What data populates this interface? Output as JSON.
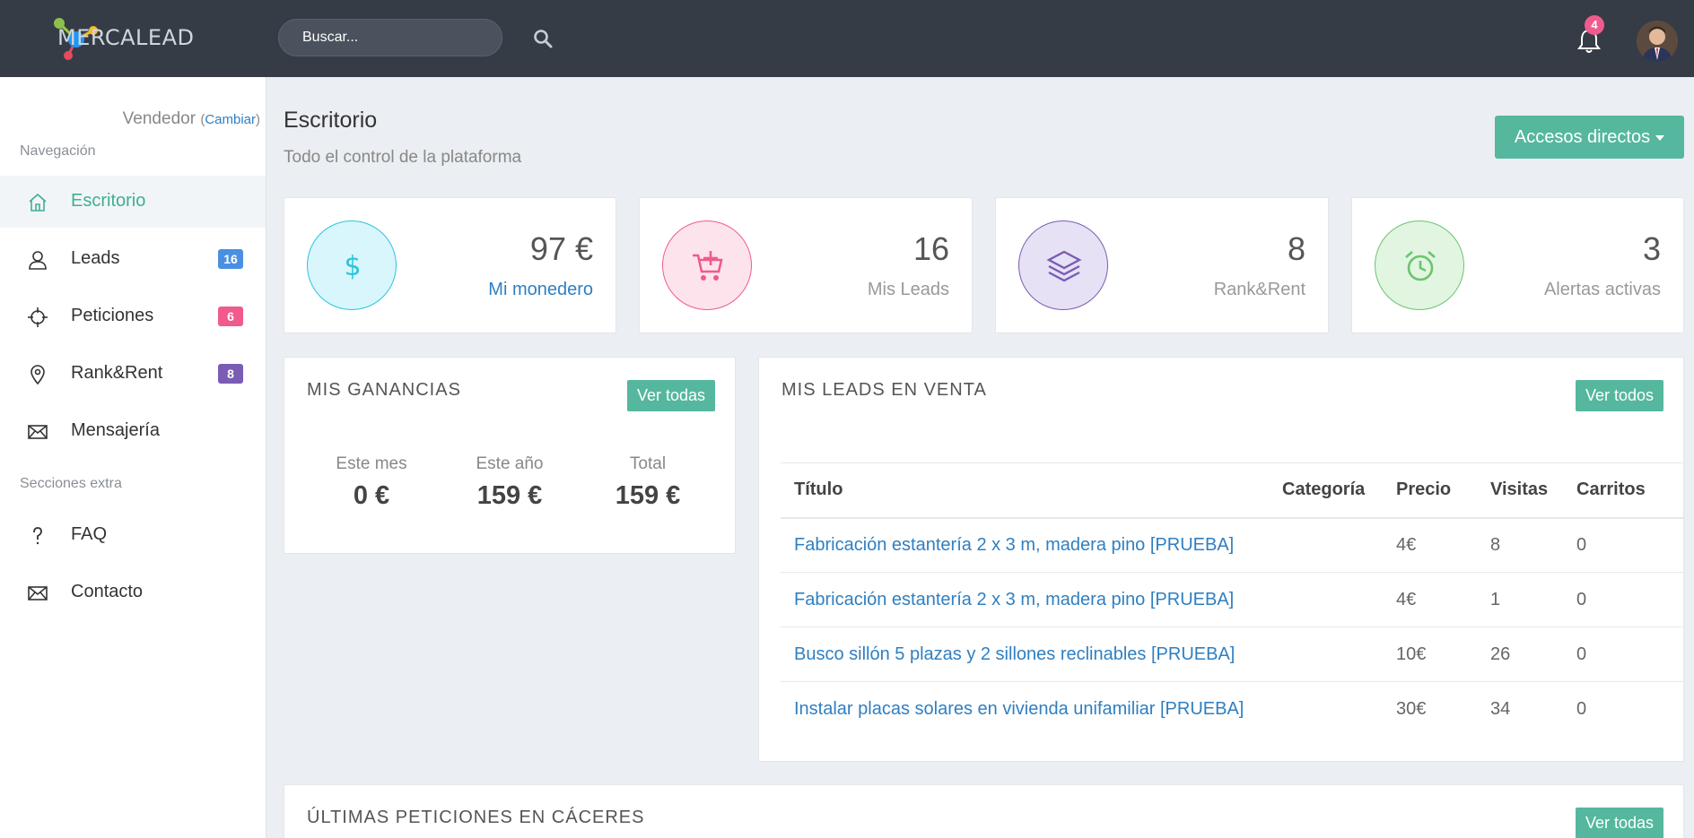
{
  "header": {
    "logo_text": "MERCALEAD",
    "search_placeholder": "Buscar...",
    "notification_count": "4"
  },
  "sidebar": {
    "role": "Vendedor",
    "change_label": "Cambiar",
    "section_nav": "Navegación",
    "section_extra": "Secciones extra",
    "items": [
      {
        "label": "Escritorio",
        "icon": "home-icon"
      },
      {
        "label": "Leads",
        "icon": "user-icon",
        "badge": "16",
        "badge_color": "#4a90e2"
      },
      {
        "label": "Peticiones",
        "icon": "crosshair-icon",
        "badge": "6",
        "badge_color": "#f05a8d"
      },
      {
        "label": "Rank&Rent",
        "icon": "map-pin-icon",
        "badge": "8",
        "badge_color": "#7a5cb5"
      },
      {
        "label": "Mensajería",
        "icon": "envelope-icon"
      }
    ],
    "extra_items": [
      {
        "label": "FAQ",
        "icon": "question-icon"
      },
      {
        "label": "Contacto",
        "icon": "envelope-icon"
      }
    ]
  },
  "page": {
    "title": "Escritorio",
    "subtitle": "Todo el control de la plataforma",
    "quick_access": "Accesos directos"
  },
  "stats": [
    {
      "value": "97 €",
      "label": "Mi monedero",
      "icon": "dollar-icon",
      "color": "#2bc4dd"
    },
    {
      "value": "16",
      "label": "Mis Leads",
      "icon": "cart-plus-icon",
      "color": "#f05a8d"
    },
    {
      "value": "8",
      "label": "Rank&Rent",
      "icon": "layers-icon",
      "color": "#7a5cb5"
    },
    {
      "value": "3",
      "label": "Alertas activas",
      "icon": "alarm-icon",
      "color": "#6cc46e"
    }
  ],
  "earnings": {
    "title": "MIS GANANCIAS",
    "button": "Ver todas",
    "items": [
      {
        "label": "Este mes",
        "value": "0 €"
      },
      {
        "label": "Este año",
        "value": "159 €"
      },
      {
        "label": "Total",
        "value": "159 €"
      }
    ]
  },
  "leads_sale": {
    "title": "MIS LEADS EN VENTA",
    "button": "Ver todos",
    "columns": [
      "Título",
      "Categoría",
      "Precio",
      "Visitas",
      "Carritos"
    ],
    "rows": [
      {
        "title": "Fabricación estantería 2 x 3 m, madera pino [PRUEBA]",
        "category": "",
        "price": "4€",
        "visits": "8",
        "carts": "0"
      },
      {
        "title": "Fabricación estantería 2 x 3 m, madera pino [PRUEBA]",
        "category": "",
        "price": "4€",
        "visits": "1",
        "carts": "0"
      },
      {
        "title": "Busco sillón 5 plazas y 2 sillones reclinables [PRUEBA]",
        "category": "",
        "price": "10€",
        "visits": "26",
        "carts": "0"
      },
      {
        "title": "Instalar placas solares en vivienda unifamiliar [PRUEBA]",
        "category": "",
        "price": "30€",
        "visits": "34",
        "carts": "0"
      }
    ]
  },
  "requests": {
    "title": "ÚLTIMAS PETICIONES EN CÁCERES",
    "button": "Ver todas"
  }
}
